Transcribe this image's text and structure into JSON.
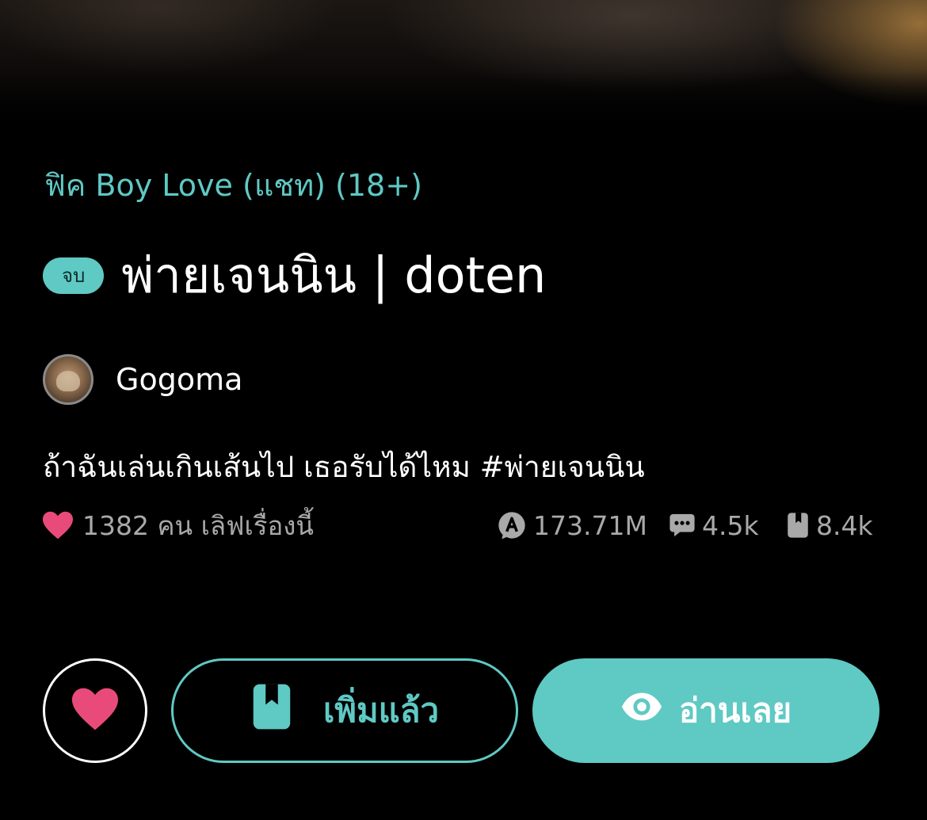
{
  "story": {
    "category": "ฟิค Boy Love (แชท) (18+)",
    "status_badge": "จบ",
    "title": "พ่ายเจนนิน | doten",
    "author": "Gogoma",
    "synopsis": "ถ้าฉันเล่นเกินเส้นไป เธอรับได้ไหม #พ่ายเจนนิน"
  },
  "stats": {
    "likes_text": "1382 คน เลิฟเรื่องนี้",
    "views": "173.71M",
    "comments": "4.5k",
    "bookmarks": "8.4k"
  },
  "actions": {
    "library_label": "เพิ่มแล้ว",
    "read_label": "อ่านเลย"
  },
  "icons": {
    "heart": "heart-icon",
    "views": "views-icon",
    "comments": "comment-icon",
    "bookmarks": "bookmark-icon",
    "eye": "eye-icon"
  },
  "colors": {
    "accent": "#5fc9c4",
    "heart": "#e84b7a",
    "background": "#000000",
    "muted_text": "#a9a9a9"
  }
}
